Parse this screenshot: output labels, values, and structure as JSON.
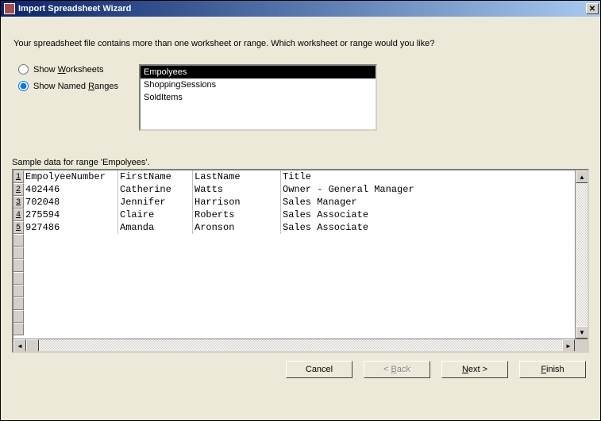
{
  "window": {
    "title": "Import Spreadsheet Wizard"
  },
  "intro": "Your spreadsheet file contains more than one worksheet or range. Which worksheet or range would you like?",
  "radios": {
    "worksheets_prefix": "Show ",
    "worksheets_u": "W",
    "worksheets_suffix": "orksheets",
    "ranges_prefix": "Show Named ",
    "ranges_u": "R",
    "ranges_suffix": "anges",
    "selected": "ranges"
  },
  "list": {
    "items": [
      "Empolyees",
      "ShoppingSessions",
      "SoldItems"
    ],
    "selected_index": 0
  },
  "sample": {
    "label": "Sample data for range 'Empolyees'.",
    "columns": [
      "EmpolyeeNumber",
      "FirstName",
      "LastName",
      "Title"
    ],
    "rows": [
      [
        "402446",
        "Catherine",
        "Watts",
        "Owner - General Manager"
      ],
      [
        "702048",
        "Jennifer",
        "Harrison",
        "Sales Manager"
      ],
      [
        "275594",
        "Claire",
        "Roberts",
        "Sales Associate"
      ],
      [
        "927486",
        "Amanda",
        "Aronson",
        "Sales Associate"
      ]
    ]
  },
  "buttons": {
    "cancel": "Cancel",
    "back_prefix": "< ",
    "back_u": "B",
    "back_suffix": "ack",
    "next_u": "N",
    "next_suffix": "ext >",
    "finish_u": "F",
    "finish_suffix": "inish"
  }
}
